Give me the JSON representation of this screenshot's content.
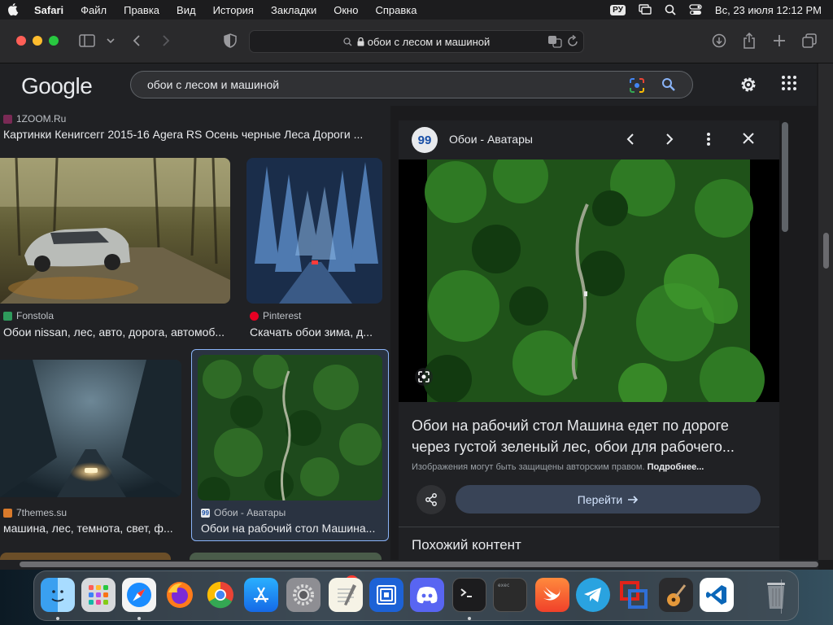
{
  "menubar": {
    "items": [
      "Safari",
      "Файл",
      "Правка",
      "Вид",
      "История",
      "Закладки",
      "Окно",
      "Справка"
    ],
    "lang": "РУ",
    "datetime": "Вс, 23 июля  12:12 PM"
  },
  "safari": {
    "url": "обои с лесом и машиной"
  },
  "google": {
    "logo": "Google",
    "query": "обои с лесом и машиной",
    "colors": {
      "blue": "#8ab4f8",
      "background": "#202124"
    }
  },
  "results": [
    {
      "source": "1ZOOM.Ru",
      "title": "Картинки Кенигсегг 2015-16 Agera RS Осень черные Леса Дороги ..."
    },
    {
      "source": "Fonstola",
      "title": "Обои nissan, лес, авто, дорога, автомоб..."
    },
    {
      "source": "Pinterest",
      "title": "Скачать обои зима, д..."
    },
    {
      "source": "7themes.su",
      "title": "машина, лес, темнота, свет, ф..."
    },
    {
      "source": "Обои - Аватары",
      "title": "Обои на рабочий стол Машина..."
    }
  ],
  "panel": {
    "badge": "99",
    "site": "Обои - Аватары",
    "title_line1": "Обои на рабочий стол Машина едет по дороге",
    "title_line2": "через густой зеленый лес, обои для рабочего...",
    "copyright": "Изображения могут быть защищены авторским правом.",
    "copyright_more": "Подробнее...",
    "go_label": "Перейти",
    "similar": "Похожий контент"
  },
  "dock": {
    "items": [
      "finder-icon",
      "launchpad-icon",
      "safari-icon",
      "firefox-icon",
      "chrome-icon",
      "app-store-icon",
      "system-settings-icon",
      "textedit-icon",
      "keynote-icon",
      "discord-icon",
      "terminal-icon",
      "console-icon",
      "swift-icon",
      "telegram-icon",
      "parallels-icon",
      "garageband-icon",
      "vscode-icon",
      "trash-icon"
    ],
    "notification_count": "1",
    "terminal_label": "exec"
  }
}
